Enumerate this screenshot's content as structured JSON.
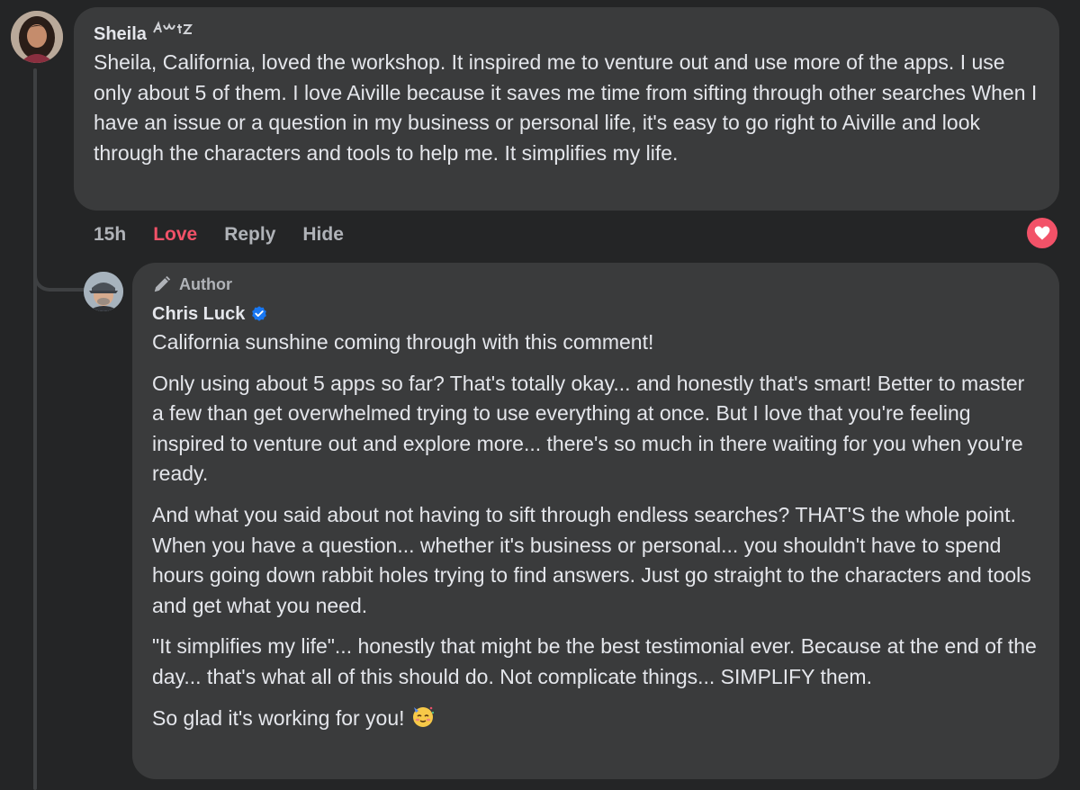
{
  "colors": {
    "background": "#242526",
    "bubble": "#3a3b3c",
    "text": "#e4e6eb",
    "secondary_text": "#b0b3b8",
    "love_red": "#f25268",
    "verified_blue": "#1877f2"
  },
  "comment": {
    "author": "Sheila",
    "author_flair_icon": "handwritten-flair",
    "text": "Sheila, California, loved the workshop. It inspired me to venture out and use more of the apps. I use only about 5 of them. I love Aiville because it saves me time from sifting through other searches When I have an issue or a question in my business or personal life, it's easy to go right to Aiville and look through the characters and tools to help me. It simplifies my life.",
    "actions": {
      "time": "15h",
      "love": "Love",
      "reply": "Reply",
      "hide": "Hide"
    },
    "reaction_icon": "heart-icon"
  },
  "reply": {
    "badge": "Author",
    "badge_icon": "pencil-icon",
    "author": "Chris Luck",
    "verified_icon": "verified-badge-icon",
    "paragraphs": [
      "California sunshine coming through with this comment!",
      "Only using about 5 apps so far? That's totally okay... and honestly that's smart! Better to master a few than get overwhelmed trying to use everything at once. But I love that you're feeling inspired to venture out and explore more... there's so much in there waiting for you when you're ready.",
      "And what you said about not having to sift through endless searches? THAT'S the whole point. When you have a question... whether it's business or personal... you shouldn't have to spend hours going down rabbit holes trying to find answers. Just go straight to the characters and tools and get what you need.",
      "\"It simplifies my life\"... honestly that might be the best testimonial ever. Because at the end of the day... that's what all of this should do. Not complicate things... SIMPLIFY them.",
      "So glad it's working for you!"
    ],
    "closing_emoji": "partying-face-emoji"
  }
}
